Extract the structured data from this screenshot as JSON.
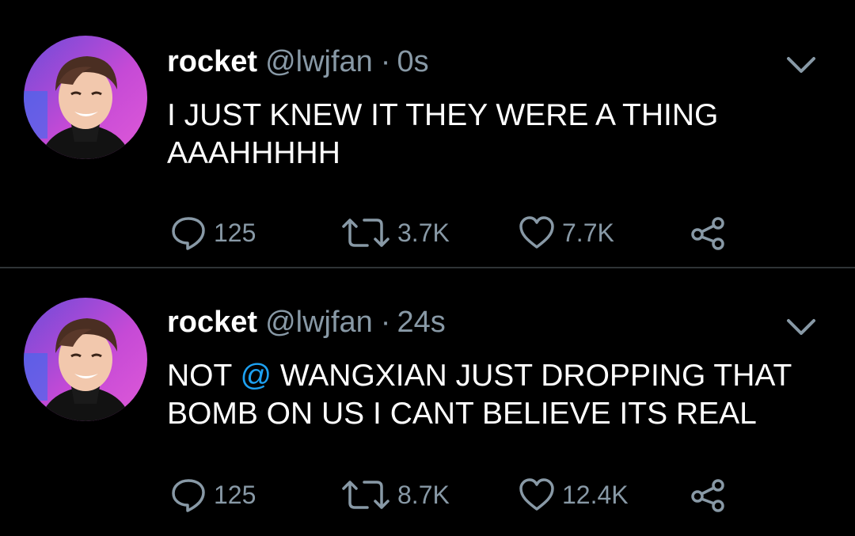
{
  "colors": {
    "background": "#000000",
    "text": "#ffffff",
    "muted": "#8899a6",
    "link": "#1da1f2",
    "divider": "#2f3336"
  },
  "tweets": [
    {
      "name": "rocket",
      "handle": "@lwjfan",
      "separator": "·",
      "time": "0s",
      "text": "I JUST KNEW IT THEY WERE A THING AAAHHHHH",
      "replies": "125",
      "retweets": "3.7K",
      "likes": "7.7K",
      "icons": [
        "chevron-down-icon",
        "reply-icon",
        "retweet-icon",
        "heart-icon",
        "share-icon"
      ]
    },
    {
      "name": "rocket",
      "handle": "@lwjfan",
      "separator": "·",
      "time": "24s",
      "text_before": "NOT ",
      "mention_at": "@",
      "text_after": " WANGXIAN JUST DROPPING THAT BOMB ON US I CANT BELIEVE ITS REAL",
      "replies": "125",
      "retweets": "8.7K",
      "likes": "12.4K",
      "icons": [
        "chevron-down-icon",
        "reply-icon",
        "retweet-icon",
        "heart-icon",
        "share-icon"
      ]
    }
  ]
}
